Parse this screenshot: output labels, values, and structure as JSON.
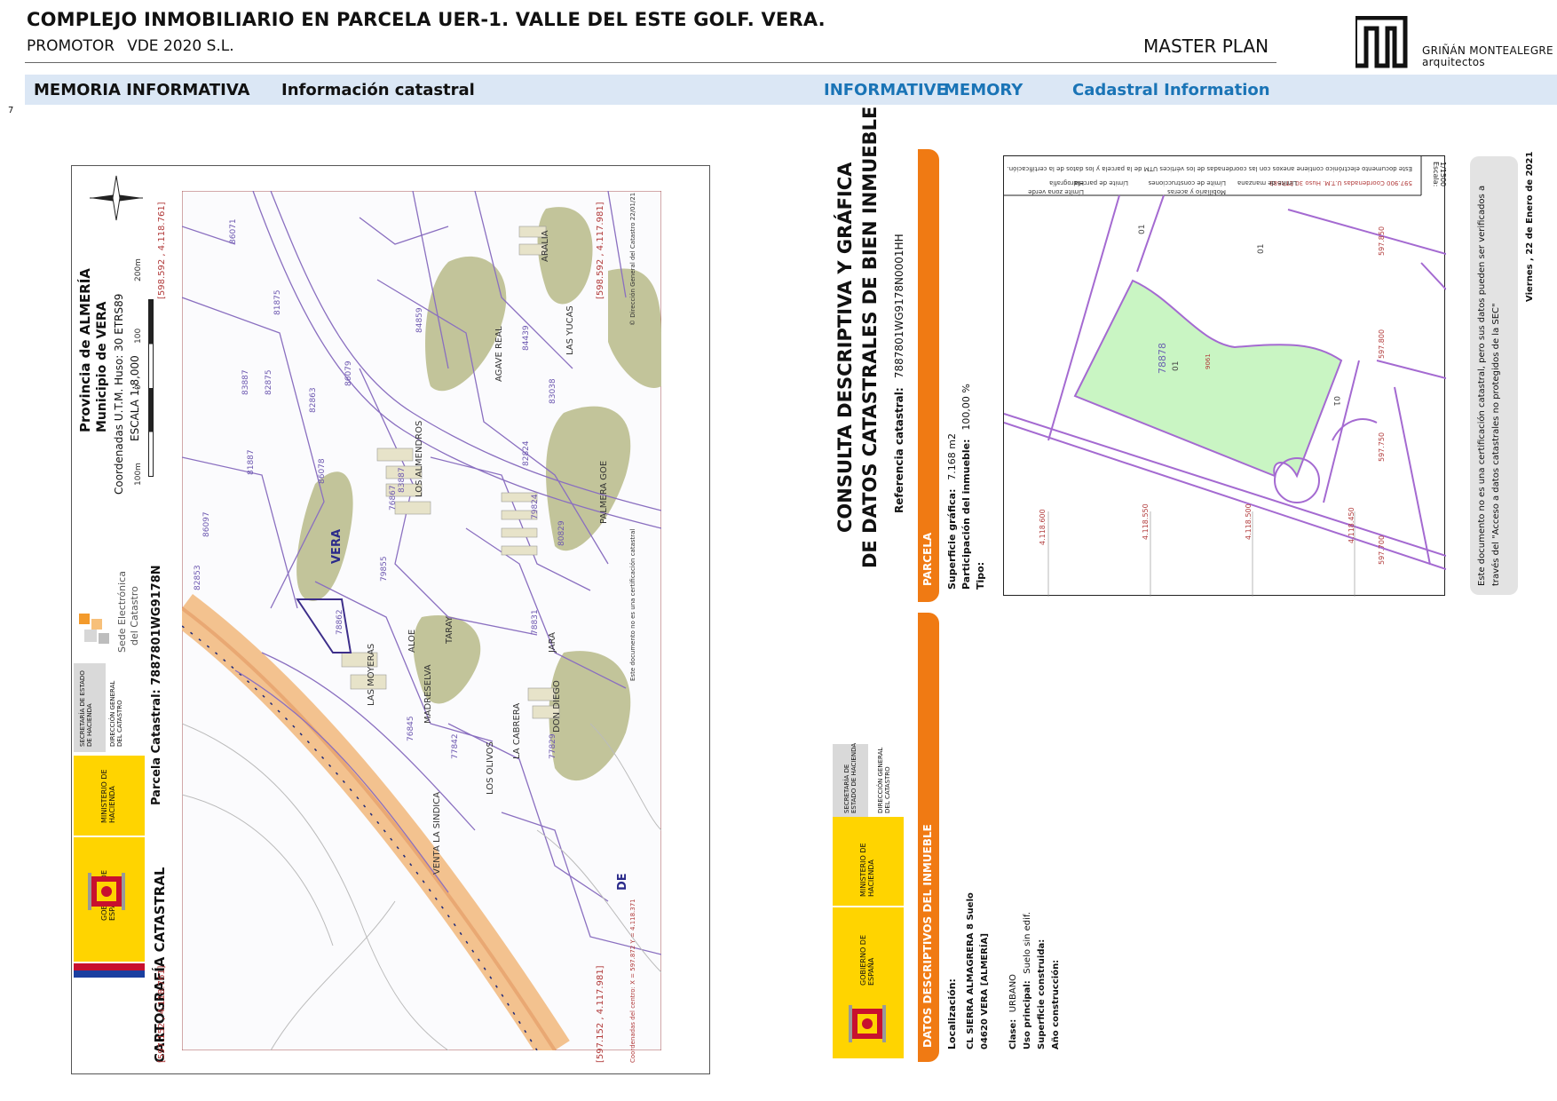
{
  "header": {
    "title": "COMPLEJO INMOBILIARIO EN PARCELA UER-1. VALLE DEL ESTE GOLF. VERA.",
    "promotor_label": "PROMOTOR",
    "promotor_value": "VDE 2020 S.L.",
    "section": "MASTER PLAN",
    "logo_line1": "GRIÑÁN MONTEALEGRE",
    "logo_line2": "arquitectos"
  },
  "band": {
    "memoria": "MEMORIA INFORMATIVA",
    "info": "Información catastral",
    "informative": "INFORMATIVE",
    "memory": "MEMORY",
    "cadastral": "Cadastral Information"
  },
  "page_number": "7",
  "left_doc": {
    "provincia": "Provincia de ALMERÍA",
    "municipio": "Municipio de VERA",
    "coordenadas": "Coordenadas U.T.M. Huso: 30 ETRS89",
    "escala": "ESCALA 1:8,000",
    "scale_ticks": [
      "100m",
      "0",
      "100",
      "200m"
    ],
    "parcela": "Parcela Catastral: 7887801WG9178N",
    "cartografia": "CARTOGRAFÍA CATASTRAL",
    "sede_line1": "Sede Electrónica",
    "sede_line2": "del Catastro",
    "ministerio": "MINISTERIO DE HACIENDA",
    "gobierno": "GOBIERNO DE ESPAÑA",
    "secretaria": "SECRETARÍA DE ESTADO DE HACIENDA",
    "direccion": "DIRECCIÓN GENERAL DEL CATASTRO",
    "coord_tl": "[598.592 , 4.118.761]",
    "coord_bl": "[597.152 , 4.118.761]",
    "coord_tr": "[598.592 , 4.117.981]",
    "coord_br": "[597.152 , 4.117.981]",
    "copyright": "© Dirección General del Catastro 22/01/21",
    "no_cert": "Este documento no es una certificación catastral",
    "centro": "Coordenadas del centro: X = 597.872 Y = 4.118.371",
    "map_labels": [
      "LOS ALMENDROS",
      "AGAVE REAL",
      "LAS YUCAS",
      "ARALIA",
      "PALMERA GOE",
      "ALOE",
      "TARAY",
      "LAS MOYERAS",
      "MADRESELVA",
      "JARA",
      "DON DIEGO",
      "VERA",
      "DE",
      "VENTA LA SINDICA",
      "LOS OLIVOS",
      "LA CABRERA"
    ],
    "parcel_numbers": [
      "86071",
      "81875",
      "83887",
      "82875",
      "82863",
      "86079",
      "84859",
      "81887",
      "86097",
      "82853",
      "86078",
      "83887",
      "84439",
      "83038",
      "82824",
      "80829",
      "79824",
      "78831",
      "77842",
      "77829",
      "76845",
      "78862",
      "76867",
      "79855"
    ]
  },
  "mid_doc": {
    "title_line1": "CONSULTA DESCRIPTIVA Y GRÁFICA",
    "title_line2": "DE DATOS CATASTRALES DE BIEN INMUEBLE",
    "referencia_label": "Referencia catastral:",
    "referencia_value": "7887801WG9178N0001HH",
    "parcela_head": "PARCELA",
    "superficie_label": "Superficie gráfica:",
    "superficie_value": "7.168 m2",
    "participacion_label": "Participación del inmueble:",
    "participacion_value": "100,00 %",
    "tipo_label": "Tipo:",
    "datos_head": "DATOS DESCRIPTIVOS DEL INMUEBLE",
    "localizacion_label": "Localización:",
    "loc_line1": "CL SIERRA ALMAGRERA 8 Suelo",
    "loc_line2": "04620 VERA [ALMERÍA]",
    "clase_label": "Clase:",
    "clase_value": "URBANO",
    "uso_label": "Uso principal:",
    "uso_value": "Suelo sin edif.",
    "construida_label": "Superficie construida:",
    "anio_label": "Año construcción:",
    "ministerio": "MINISTERIO DE HACIENDA",
    "gobierno": "GOBIERNO DE ESPAÑA",
    "secretaria": "SECRETARÍA DE ESTADO DE HACIENDA",
    "direccion": "DIRECCIÓN GENERAL DEL CATASTRO"
  },
  "right_doc": {
    "escala_label": "Escala:",
    "escala_value": "1/1500",
    "legend_coords": "597.900 Coordenadas U.T.M. Huso 30 ETRS89",
    "legend_items": [
      "Límite de manzana",
      "Límite de parcela",
      "Límite de construcciones",
      "Mobiliario y aceras",
      "Límite zona verde",
      "Hidrografía"
    ],
    "legend_note": "Este documento electrónico contiene anexos con las coordenadas de los vértices UTM de la parcela y los datos de la certificación.",
    "parcel_label": "78878",
    "parcel_sub": "01",
    "label_01": "01",
    "label_01b": "01",
    "label_01c": "01",
    "label_small": "9061",
    "y_coords": [
      "4.118.600",
      "4.118.550",
      "4.118.500",
      "4.118.450"
    ],
    "x_coords": [
      "597.850",
      "597.800",
      "597.750",
      "597.700"
    ],
    "disclaimer_line1": "Este documento no es una certificación catastral, pero sus datos pueden ser verificados a",
    "disclaimer_line2": "través del \"Acceso a datos catastrales no protegidos de la SEC\"",
    "fecha": "Viernes , 22 de Enero de 2021"
  }
}
